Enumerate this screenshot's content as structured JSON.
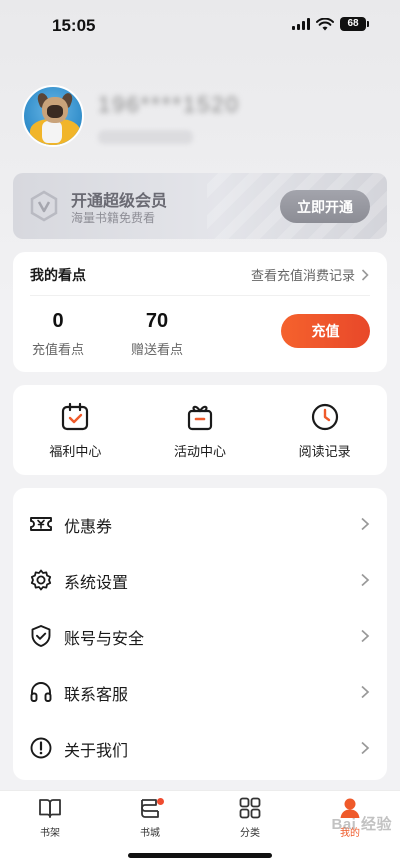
{
  "status_bar": {
    "time": "15:05",
    "battery": "68"
  },
  "profile": {
    "username": "196****1520"
  },
  "vip": {
    "title": "开通超级会员",
    "subtitle": "海量书籍免费看",
    "button": "立即开通"
  },
  "points": {
    "title": "我的看点",
    "link": "查看充值消费记录",
    "recharged_value": "0",
    "recharged_label": "充值看点",
    "gift_value": "70",
    "gift_label": "赠送看点",
    "recharge_button": "充值"
  },
  "quick_actions": [
    {
      "label": "福利中心",
      "icon": "calendar-check-icon"
    },
    {
      "label": "活动中心",
      "icon": "gift-icon"
    },
    {
      "label": "阅读记录",
      "icon": "clock-icon"
    }
  ],
  "menu": [
    {
      "label": "优惠券",
      "icon": "coupon-icon"
    },
    {
      "label": "系统设置",
      "icon": "gear-icon"
    },
    {
      "label": "账号与安全",
      "icon": "shield-check-icon"
    },
    {
      "label": "联系客服",
      "icon": "headphones-icon"
    },
    {
      "label": "关于我们",
      "icon": "info-icon"
    }
  ],
  "tabs": [
    {
      "label": "书架",
      "icon": "book-icon"
    },
    {
      "label": "书城",
      "icon": "bookstore-icon"
    },
    {
      "label": "分类",
      "icon": "grid-icon"
    },
    {
      "label": "我的",
      "icon": "user-icon",
      "active": true
    }
  ],
  "colors": {
    "accent": "#ef5a2a",
    "background": "#f2f2f4"
  },
  "watermark": "Bai 经验"
}
